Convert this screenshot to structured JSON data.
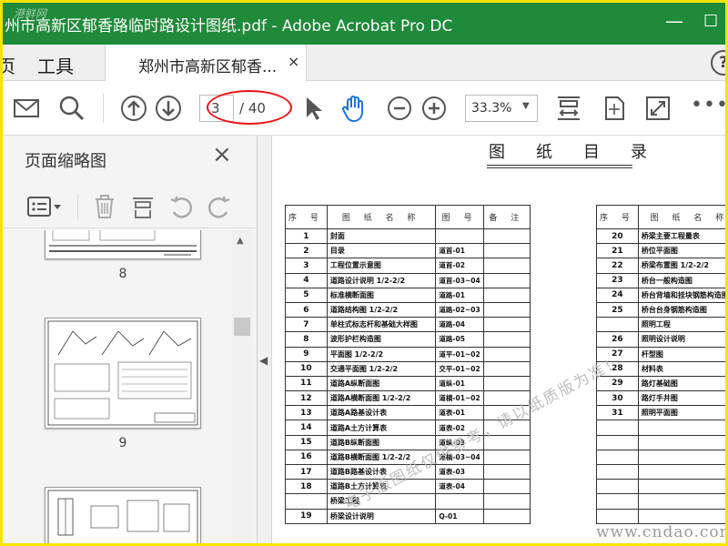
{
  "window": {
    "title": "州市高新区郁香路临时路设计图纸.pdf - Adobe Acrobat Pro DC",
    "logo_text": "港鲜网",
    "minimize": "—",
    "maximize": "☐"
  },
  "tabs": {
    "home": "页",
    "tools": "工具",
    "document": "郑州市高新区郁香...",
    "close": "×",
    "help": "?"
  },
  "toolbar": {
    "current_page": "3",
    "total_pages": "/ 40",
    "zoom": "33.3%"
  },
  "side_panel": {
    "title": "页面缩略图",
    "close": "×",
    "thumbnails": [
      {
        "label": "8"
      },
      {
        "label": "9"
      }
    ]
  },
  "document": {
    "title": "图纸目录",
    "left_table": {
      "headers": [
        "序 号",
        "图 纸 名 称",
        "图 号",
        "备 注"
      ],
      "rows": [
        [
          "1",
          "封面",
          "",
          ""
        ],
        [
          "2",
          "目录",
          "道首-01",
          ""
        ],
        [
          "3",
          "工程位置示意图",
          "道首-02",
          ""
        ],
        [
          "4",
          "道路设计说明 1/2-2/2",
          "道首-03~04",
          ""
        ],
        [
          "5",
          "标准横断面图",
          "道路-01",
          ""
        ],
        [
          "6",
          "道路结构图 1/2-2/2",
          "道路-02~03",
          ""
        ],
        [
          "7",
          "单柱式标志杆和基础大样图",
          "道路-04",
          ""
        ],
        [
          "8",
          "波形护栏构造图",
          "道路-05",
          ""
        ],
        [
          "9",
          "平面图 1/2-2/2",
          "道平-01~02",
          ""
        ],
        [
          "10",
          "交通平面图 1/2-2/2",
          "交平-01~02",
          ""
        ],
        [
          "11",
          "道路A纵断面图",
          "道纵-01",
          ""
        ],
        [
          "12",
          "道路A横断面图 1/2-2/2",
          "道横-01~02",
          ""
        ],
        [
          "13",
          "道路A路基设计表",
          "道表-01",
          ""
        ],
        [
          "14",
          "道路A土方计算表",
          "道表-02",
          ""
        ],
        [
          "15",
          "道路B纵断面图",
          "道纵-03",
          ""
        ],
        [
          "16",
          "道路B横断面图 1/2-2/2",
          "道横-03~04",
          ""
        ],
        [
          "17",
          "道路B路基设计表",
          "道表-03",
          ""
        ],
        [
          "18",
          "道路B土方计算表",
          "道表-04",
          ""
        ],
        [
          "",
          "桥梁工程",
          "",
          ""
        ],
        [
          "19",
          "桥梁设计说明",
          "Q-01",
          ""
        ]
      ]
    },
    "right_table": {
      "headers": [
        "序 号",
        "图 纸 名 称"
      ],
      "rows": [
        [
          "20",
          "桥梁主要工程量表"
        ],
        [
          "21",
          "桥位平面图"
        ],
        [
          "22",
          "桥梁布置图 1/2-2/2"
        ],
        [
          "23",
          "桥台一般构造图"
        ],
        [
          "24",
          "桥台背墙和挂块钢筋构造图"
        ],
        [
          "25",
          "桥台台身钢筋构造图"
        ],
        [
          "",
          "照明工程"
        ],
        [
          "26",
          "照明设计说明"
        ],
        [
          "27",
          "杆型图"
        ],
        [
          "28",
          "材料表"
        ],
        [
          "29",
          "路灯基础图"
        ],
        [
          "30",
          "路灯手井图"
        ],
        [
          "31",
          "照明平面图"
        ],
        [
          "",
          ""
        ],
        [
          "",
          ""
        ],
        [
          "",
          ""
        ],
        [
          "",
          ""
        ],
        [
          "",
          ""
        ],
        [
          "",
          ""
        ],
        [
          "",
          ""
        ]
      ]
    },
    "watermark": "电子版图纸仅供参考，请以纸质版为准！",
    "site": "www.cndao.com"
  },
  "colors": {
    "titlebar": "#1f8a3a",
    "frame": "#f5e400",
    "accent_hand": "#1a73e8",
    "annotation_circle": "#e11111"
  }
}
